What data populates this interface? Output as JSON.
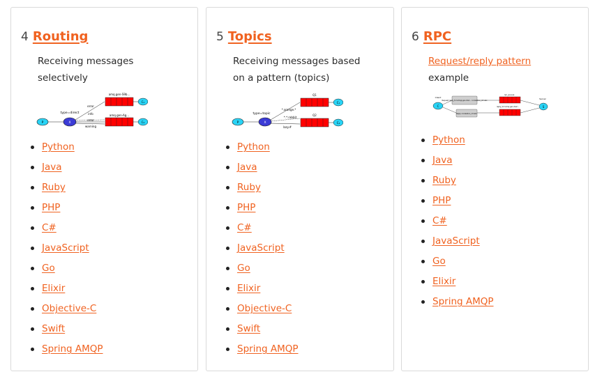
{
  "cards": [
    {
      "number": "4",
      "title": "Routing",
      "description": "Receiving messages selectively",
      "diagram": {
        "producer": "P",
        "exchange": "X",
        "exchange_type": "type=direct",
        "queue1_name": "amq.gen-S9b...",
        "queue2_name": "amq.gen-Ag...",
        "bindings": [
          "error",
          "info",
          "error",
          "warning"
        ],
        "consumer1": "C₁",
        "consumer2": "C₂"
      },
      "languages": [
        "Python",
        "Java",
        "Ruby",
        "PHP",
        "C#",
        "JavaScript",
        "Go",
        "Elixir",
        "Objective-C",
        "Swift",
        "Spring AMQP"
      ]
    },
    {
      "number": "5",
      "title": "Topics",
      "description": "Receiving messages based on a pattern (topics)",
      "diagram": {
        "producer": "P",
        "exchange": "X",
        "exchange_type": "type=topic",
        "queue1_name": "Q1",
        "queue2_name": "Q2",
        "bindings": [
          "*.orange.*",
          "*.*.rabbit",
          "lazy.#"
        ],
        "consumer1": "C₁",
        "consumer2": "C₂"
      },
      "languages": [
        "Python",
        "Java",
        "Ruby",
        "PHP",
        "C#",
        "JavaScript",
        "Go",
        "Elixir",
        "Objective-C",
        "Swift",
        "Spring AMQP"
      ]
    },
    {
      "number": "6",
      "title": "RPC",
      "description_link": "Request/reply pattern",
      "description_rest": "example",
      "diagram": {
        "client": "C",
        "server": "S",
        "client_label": "Client",
        "server_label": "Server",
        "request_box": "Request reply_to=amqp.gen-Xa2... correlation_id=abc",
        "reply_box": "Reply correlation_id=abc",
        "rpc_queue": "rpc_queue",
        "reply_queue": "reply_to=amq.gen-Xa2..."
      },
      "languages": [
        "Python",
        "Java",
        "Ruby",
        "PHP",
        "C#",
        "JavaScript",
        "Go",
        "Elixir",
        "Spring AMQP"
      ]
    }
  ],
  "colors": {
    "accent": "#f06220",
    "queue_red": "#ff0000",
    "node_cyan": "#29d3f5",
    "exchange_blue": "#3b3bd6"
  }
}
